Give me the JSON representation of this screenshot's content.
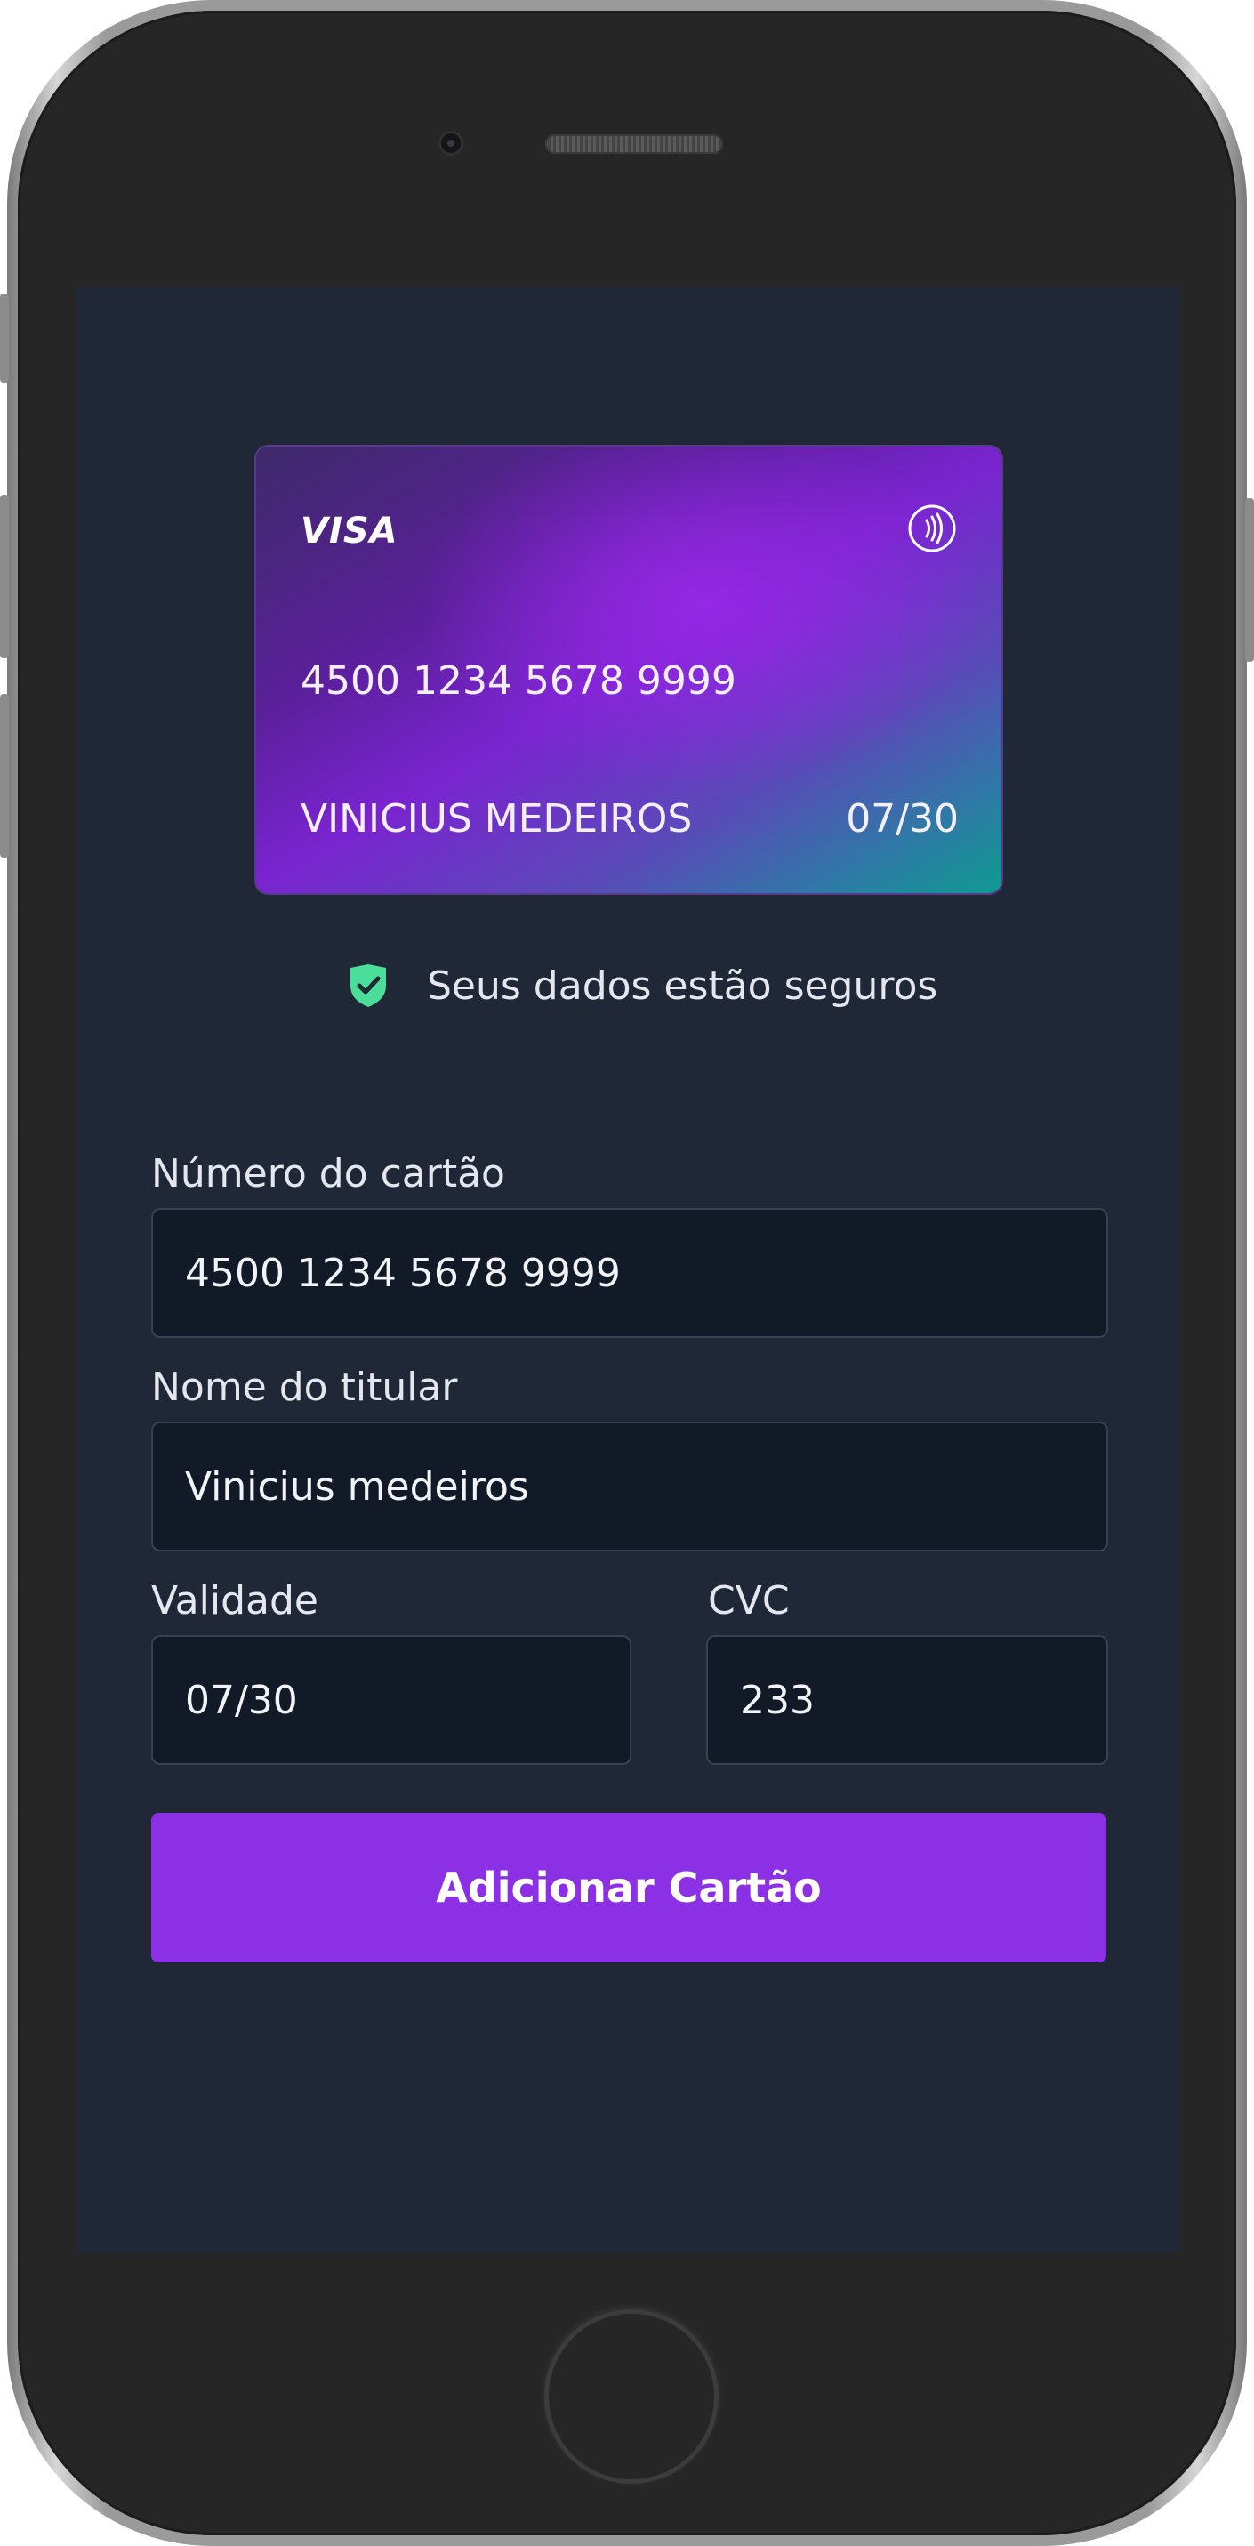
{
  "card_preview": {
    "brand": "VISA",
    "number": "4500 1234 5678 9999",
    "holder": "VINICIUS MEDEIROS",
    "expiry": "07/30",
    "contactless_icon": "nfc-icon",
    "gradient_colors": [
      "#5a209a",
      "#7a24d0",
      "#0f9a90"
    ]
  },
  "security_note": {
    "icon": "shield-check-icon",
    "text": "Seus dados estão seguros",
    "icon_color": "#4ade9a"
  },
  "form": {
    "card_number": {
      "label": "Número do cartão",
      "value": "4500 1234 5678 9999"
    },
    "holder_name": {
      "label": "Nome do titular",
      "value": "Vinicius medeiros"
    },
    "expiry": {
      "label": "Validade",
      "value": "07/30"
    },
    "cvc": {
      "label": "CVC",
      "value": "233"
    },
    "submit_label": "Adicionar Cartão",
    "accent_color": "#8c30e6"
  }
}
